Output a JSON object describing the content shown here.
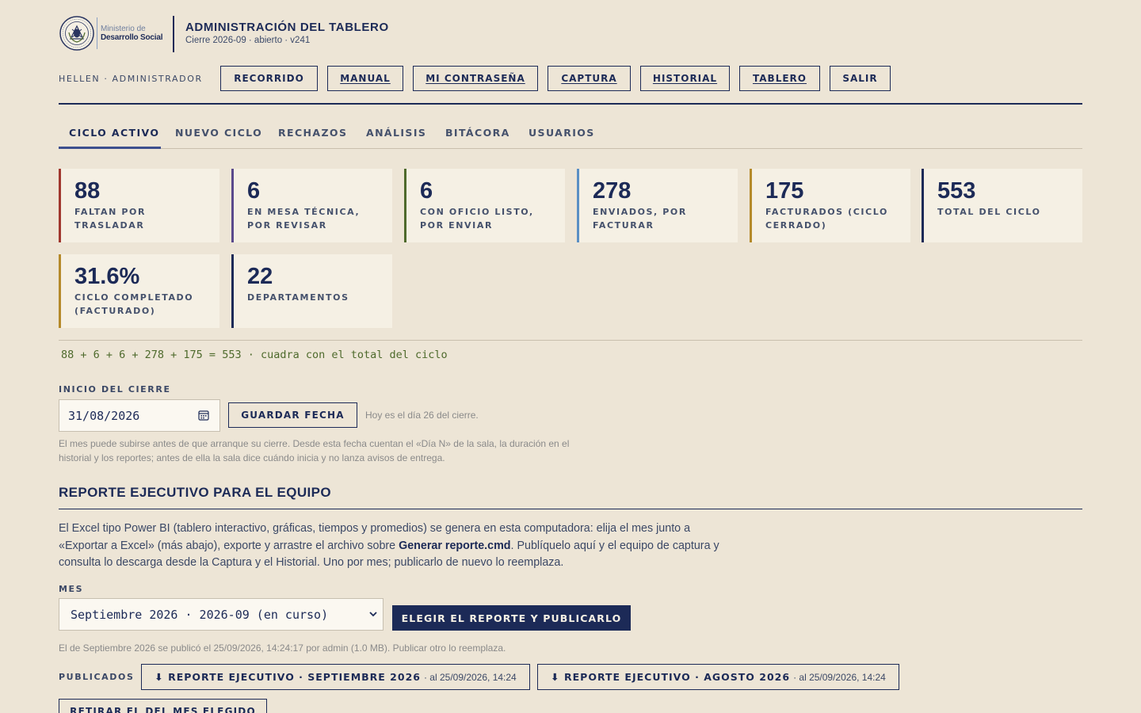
{
  "header": {
    "logo": {
      "line1": "Ministerio de",
      "line2": "Desarrollo Social"
    },
    "title": "ADMINISTRACIÓN DEL TABLERO",
    "subtitle": "Cierre 2026-09 · abierto · v241"
  },
  "nav": {
    "user": "HELLEN · ADMINISTRADOR",
    "buttons": [
      "RECORRIDO",
      "MANUAL",
      "MI CONTRASEÑA",
      "CAPTURA",
      "HISTORIAL",
      "TABLERO",
      "SALIR"
    ]
  },
  "tabs": [
    "CICLO ACTIVO",
    "NUEVO CICLO",
    "RECHAZOS",
    "ANÁLISIS",
    "BITÁCORA",
    "USUARIOS"
  ],
  "active_tab": "CICLO ACTIVO",
  "stats": [
    {
      "value": "88",
      "label": "FALTAN POR TRASLADAR",
      "color": "#a0382f"
    },
    {
      "value": "6",
      "label": "EN MESA TÉCNICA, POR REVISAR",
      "color": "#5a4a8c"
    },
    {
      "value": "6",
      "label": "CON OFICIO LISTO, POR ENVIAR",
      "color": "#4e6a2c"
    },
    {
      "value": "278",
      "label": "ENVIADOS, POR FACTURAR",
      "color": "#5a8fc4"
    },
    {
      "value": "175",
      "label": "FACTURADOS (CICLO CERRADO)",
      "color": "#b58a2a"
    },
    {
      "value": "553",
      "label": "TOTAL DEL CICLO",
      "color": "#1c2a57"
    },
    {
      "value": "31.6%",
      "label": "CICLO COMPLETADO (FACTURADO)",
      "color": "#b58a2a"
    },
    {
      "value": "22",
      "label": "DEPARTAMENTOS",
      "color": "#1c2a57"
    }
  ],
  "equation": "88 + 6 + 6 + 278 + 175 = 553 · cuadra con el total del ciclo",
  "cierre": {
    "label": "INICIO DEL CIERRE",
    "date_value": "31/08/2026",
    "save_button": "GUARDAR FECHA",
    "today_hint": "Hoy es el día 26 del cierre.",
    "note_line1": "El mes puede subirse antes de que arranque su cierre. Desde esta fecha cuentan el «Día N» de la sala, la duración en el",
    "note_line2": "historial y los reportes; antes de ella la sala dice cuándo inicia y no lanza avisos de entrega."
  },
  "reporte": {
    "title": "REPORTE EJECUTIVO PARA EL EQUIPO",
    "p1": "El Excel tipo Power BI (tablero interactivo, gráficas, tiempos y promedios) se genera en esta computadora: elija el mes junto a",
    "p2a": "«Exportar a Excel» (más abajo), exporte y arrastre el archivo sobre ",
    "p2b": "Generar reporte.cmd",
    "p2c": ". Publíquelo aquí y el equipo de captura y",
    "p3": "consulta lo descarga desde la Captura y el Historial. Uno por mes; publicarlo de nuevo lo reemplaza.",
    "mes_label": "MES",
    "mes_selected": "Septiembre 2026 · 2026-09 (en curso)",
    "publish_button": "ELEGIR EL REPORTE Y PUBLICARLO",
    "published_note": "El de Septiembre 2026 se publicó el 25/09/2026, 14:24:17 por admin (1.0 MB). Publicar otro lo reemplaza.",
    "publicados_label": "PUBLICADOS",
    "publicados": [
      {
        "label": "⬇ REPORTE EJECUTIVO · SEPTIEMBRE 2026",
        "meta": "· al 25/09/2026, 14:24"
      },
      {
        "label": "⬇ REPORTE EJECUTIVO · AGOSTO 2026",
        "meta": "· al 25/09/2026, 14:24"
      }
    ],
    "withdraw_button": "RETIRAR EL DEL MES ELEGIDO"
  }
}
